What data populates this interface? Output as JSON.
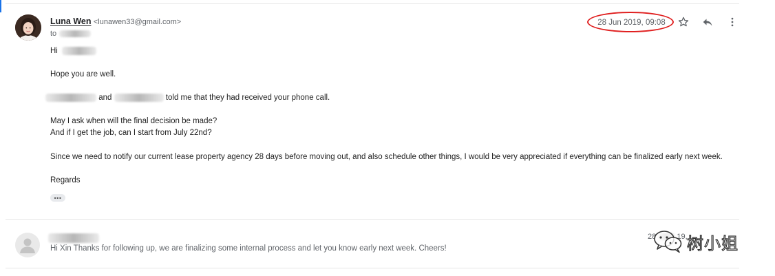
{
  "message": {
    "sender_name": "Luna Wen",
    "sender_email": "<lunawen33@gmail.com>",
    "to_label": "to",
    "timestamp": "28 Jun 2019, 09:08",
    "body": {
      "greeting": "Hi",
      "line_1": "Hope you are well.",
      "line_2_mid": "and",
      "line_2_end": "told me that they had received your phone call.",
      "line_3": "May I ask when will the final decision be made?",
      "line_4": "And if I get the job, can I start from July 22nd?",
      "line_5": "Since we need to notify our current lease property agency 28 days before moving out, and also schedule other things, I would be very appreciated if everything can be finalized early next week.",
      "sign_off": "Regards"
    },
    "trimmed_content_label": "•••"
  },
  "reply": {
    "snippet": "Hi Xin Thanks for following up, we are finalizing some internal process and let you know early next week. Cheers!",
    "date_partial": "28",
    "date_tail": "19,"
  },
  "watermark": {
    "text": "树小姐"
  },
  "colors": {
    "highlight_ring": "#e02020",
    "accent": "#1a73e8"
  },
  "icons": [
    "star-icon",
    "reply-icon",
    "more-vert-icon",
    "person-icon",
    "wechat-icon"
  ]
}
